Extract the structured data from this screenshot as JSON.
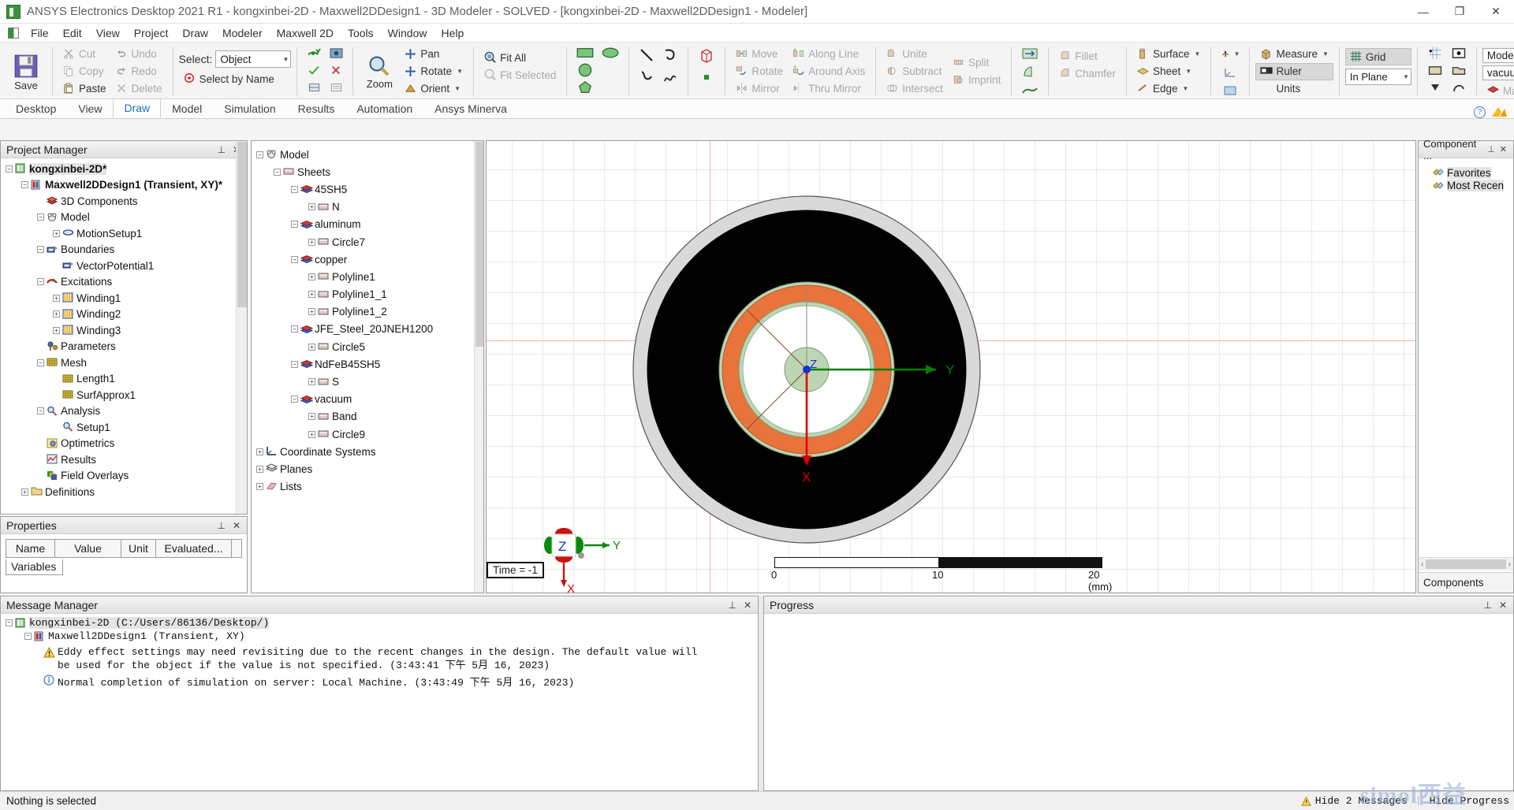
{
  "window": {
    "title": "ANSYS Electronics Desktop 2021 R1 - kongxinbei-2D - Maxwell2DDesign1 - 3D Modeler - SOLVED - [kongxinbei-2D - Maxwell2DDesign1 - Modeler]",
    "minimize": "—",
    "maximize": "❐",
    "close": "✕"
  },
  "menu": {
    "items": [
      "File",
      "Edit",
      "View",
      "Project",
      "Draw",
      "Modeler",
      "Maxwell 2D",
      "Tools",
      "Window",
      "Help"
    ]
  },
  "ribbon": {
    "save_label": "Save",
    "clipboard": [
      "Cut",
      "Copy",
      "Paste",
      "Undo",
      "Redo",
      "Delete"
    ],
    "select_label": "Select:",
    "select_value": "Object",
    "select_by_name": "Select by Name",
    "zoom_label": "Zoom",
    "view_buttons": [
      "Pan",
      "Rotate",
      "Orient"
    ],
    "fit_all": "Fit All",
    "fit_selected": "Fit Selected",
    "modify": [
      "Move",
      "Rotate",
      "Mirror",
      "Along Line",
      "Around Axis",
      "Thru Mirror"
    ],
    "boolean": [
      "Unite",
      "Split",
      "Subtract",
      "Imprint",
      "Intersect"
    ],
    "features": [
      "Fillet",
      "Chamfer"
    ],
    "surface": "Surface",
    "sheet": "Sheet",
    "edge": "Edge",
    "measure": "Measure",
    "ruler": "Ruler",
    "units": "Units",
    "grid": "Grid",
    "in_plane": "In Plane",
    "model_combo": "Model",
    "material_combo": "vacuum",
    "material_label": "Material"
  },
  "tabs": {
    "items": [
      "Desktop",
      "View",
      "Draw",
      "Model",
      "Simulation",
      "Results",
      "Automation",
      "Ansys Minerva"
    ],
    "selected": "Draw"
  },
  "project_manager": {
    "title": "Project Manager",
    "nodes": [
      {
        "label": "kongxinbei-2D*",
        "indent": 0,
        "exp": "-",
        "icon": "project-icon",
        "bold": true,
        "hl": true
      },
      {
        "label": "Maxwell2DDesign1 (Transient, XY)*",
        "indent": 1,
        "exp": "-",
        "icon": "design-icon",
        "bold": true
      },
      {
        "label": "3D Components",
        "indent": 2,
        "exp": "",
        "icon": "components-icon"
      },
      {
        "label": "Model",
        "indent": 2,
        "exp": "-",
        "icon": "model-icon"
      },
      {
        "label": "MotionSetup1",
        "indent": 3,
        "exp": "+",
        "icon": "motion-icon"
      },
      {
        "label": "Boundaries",
        "indent": 2,
        "exp": "-",
        "icon": "boundary-icon"
      },
      {
        "label": "VectorPotential1",
        "indent": 3,
        "exp": "",
        "icon": "boundary-icon"
      },
      {
        "label": "Excitations",
        "indent": 2,
        "exp": "-",
        "icon": "excitation-icon"
      },
      {
        "label": "Winding1",
        "indent": 3,
        "exp": "+",
        "icon": "winding-icon"
      },
      {
        "label": "Winding2",
        "indent": 3,
        "exp": "+",
        "icon": "winding-icon"
      },
      {
        "label": "Winding3",
        "indent": 3,
        "exp": "+",
        "icon": "winding-icon"
      },
      {
        "label": "Parameters",
        "indent": 2,
        "exp": "",
        "icon": "parameters-icon"
      },
      {
        "label": "Mesh",
        "indent": 2,
        "exp": "-",
        "icon": "mesh-icon"
      },
      {
        "label": "Length1",
        "indent": 3,
        "exp": "",
        "icon": "mesh-icon"
      },
      {
        "label": "SurfApprox1",
        "indent": 3,
        "exp": "",
        "icon": "mesh-icon"
      },
      {
        "label": "Analysis",
        "indent": 2,
        "exp": "-",
        "icon": "analysis-icon"
      },
      {
        "label": "Setup1",
        "indent": 3,
        "exp": "",
        "icon": "analysis-icon"
      },
      {
        "label": "Optimetrics",
        "indent": 2,
        "exp": "",
        "icon": "optimetrics-icon"
      },
      {
        "label": "Results",
        "indent": 2,
        "exp": "",
        "icon": "results-icon"
      },
      {
        "label": "Field Overlays",
        "indent": 2,
        "exp": "",
        "icon": "fields-icon"
      },
      {
        "label": "Definitions",
        "indent": 1,
        "exp": "+",
        "icon": "folder-icon"
      }
    ]
  },
  "properties": {
    "title": "Properties",
    "columns": [
      "Name",
      "Value",
      "Unit",
      "Evaluated..."
    ],
    "tab": "Variables"
  },
  "model_tree": {
    "nodes": [
      {
        "label": "Model",
        "indent": 0,
        "exp": "-",
        "icon": "model-icon"
      },
      {
        "label": "Sheets",
        "indent": 1,
        "exp": "-",
        "icon": "sheet-icon"
      },
      {
        "label": "45SH5",
        "indent": 2,
        "exp": "-",
        "icon": "material-icon"
      },
      {
        "label": "N",
        "indent": 3,
        "exp": "+",
        "icon": "sheet-icon"
      },
      {
        "label": "aluminum",
        "indent": 2,
        "exp": "-",
        "icon": "material-icon"
      },
      {
        "label": "Circle7",
        "indent": 3,
        "exp": "+",
        "icon": "sheet-icon"
      },
      {
        "label": "copper",
        "indent": 2,
        "exp": "-",
        "icon": "material-icon"
      },
      {
        "label": "Polyline1",
        "indent": 3,
        "exp": "+",
        "icon": "sheet-icon"
      },
      {
        "label": "Polyline1_1",
        "indent": 3,
        "exp": "+",
        "icon": "sheet-icon"
      },
      {
        "label": "Polyline1_2",
        "indent": 3,
        "exp": "+",
        "icon": "sheet-icon"
      },
      {
        "label": "JFE_Steel_20JNEH1200",
        "indent": 2,
        "exp": "-",
        "icon": "material-icon"
      },
      {
        "label": "Circle5",
        "indent": 3,
        "exp": "+",
        "icon": "sheet-icon"
      },
      {
        "label": "NdFeB45SH5",
        "indent": 2,
        "exp": "-",
        "icon": "material-icon"
      },
      {
        "label": "S",
        "indent": 3,
        "exp": "+",
        "icon": "sheet-icon"
      },
      {
        "label": "vacuum",
        "indent": 2,
        "exp": "-",
        "icon": "material-icon"
      },
      {
        "label": "Band",
        "indent": 3,
        "exp": "+",
        "icon": "sheet-icon"
      },
      {
        "label": "Circle9",
        "indent": 3,
        "exp": "+",
        "icon": "sheet-icon"
      },
      {
        "label": "Coordinate Systems",
        "indent": 0,
        "exp": "+",
        "icon": "coordinate-icon"
      },
      {
        "label": "Planes",
        "indent": 0,
        "exp": "+",
        "icon": "planes-icon"
      },
      {
        "label": "Lists",
        "indent": 0,
        "exp": "+",
        "icon": "lists-icon"
      }
    ]
  },
  "view3d": {
    "time_label": "Time = -1",
    "axis_x": "X",
    "axis_y": "Y",
    "axis_z": "Z",
    "triad_x": "X",
    "triad_y": "Y",
    "triad_z": "Z",
    "scale_ticks": [
      "0",
      "10",
      "20 (mm)"
    ],
    "colors": {
      "outer_ring": "#d9d9d9",
      "stator": "#000000",
      "coil": "#e8743b",
      "band": "#b9d4b4",
      "shaft": "#b9d4b4",
      "air": "#ffffff",
      "x_axis": "#e00000",
      "y_axis": "#008000",
      "z_axis": "#1a30d0"
    }
  },
  "components_panel": {
    "title": "Component ...",
    "items": [
      "Favorites",
      "Most Recen"
    ],
    "footer": "Components"
  },
  "message_manager": {
    "title": "Message Manager",
    "rows": [
      {
        "type": "project",
        "text": "kongxinbei-2D  (C:/Users/86136/Desktop/)",
        "indent": 0
      },
      {
        "type": "design",
        "text": "Maxwell2DDesign1  (Transient, XY)",
        "indent": 1
      },
      {
        "type": "warning",
        "text": "Eddy effect settings may need revisiting due to the recent changes in the design.   The default value will",
        "text2": "be used for the object if the value is not specified.   (3:43:41 下午  5月 16, 2023)",
        "indent": 2
      },
      {
        "type": "info",
        "text": "Normal completion of simulation on server: Local Machine. (3:43:49 下午  5月 16, 2023)",
        "indent": 2
      }
    ]
  },
  "progress": {
    "title": "Progress"
  },
  "status": {
    "text": "Nothing is selected",
    "hide_messages": "Hide 2 Messages",
    "hide_progress": "Hide Progress",
    "watermark": "simol西益"
  }
}
